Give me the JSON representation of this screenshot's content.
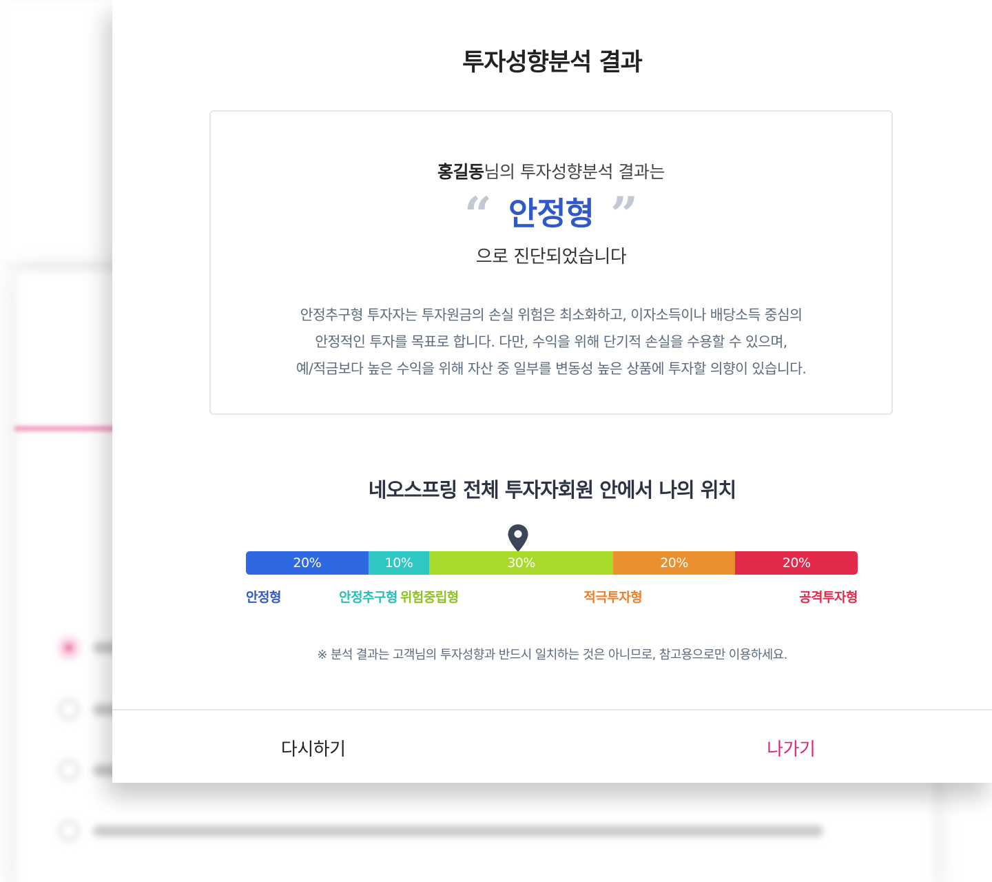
{
  "modal": {
    "title": "투자성향분석 결과"
  },
  "result": {
    "user_name": "홍길동",
    "intro_suffix": "님의 투자성향분석 결과는",
    "open_quote": "“",
    "close_quote": "”",
    "type": "안정형",
    "diagnosis_suffix": "으로 진단되었습니다",
    "description": [
      "안정추구형 투자자는 투자원금의 손실 위험은 최소화하고, 이자소득이나 배당소득 중심의",
      "안정적인 투자를 목표로 합니다. 다만, 수익을 위해 단기적 손실을 수용할 수 있으며,",
      "예/적금보다 높은 수익을 위해 자산 중 일부를 변동성 높은 상품에 투자할 의향이 있습니다."
    ]
  },
  "position": {
    "title": "네오스프링 전체 투자자회원 안에서 나의 위치",
    "pin_icon": "location-pin-icon",
    "segments": [
      {
        "name": "안정형",
        "share": 20,
        "label": "20%",
        "color": "#2f68e3",
        "label_color": "#2f59c9"
      },
      {
        "name": "안정추구형",
        "share": 10,
        "label": "10%",
        "color": "#2ec7c4",
        "label_color": "#27bdb8"
      },
      {
        "name": "위험중립형",
        "share": 30,
        "label": "30%",
        "color": "#a9d92a",
        "label_color": "#8cc21e"
      },
      {
        "name": "적극투자형",
        "share": 20,
        "label": "20%",
        "color": "#ea8f2e",
        "label_color": "#ea7e2a"
      },
      {
        "name": "공격투자형",
        "share": 20,
        "label": "20%",
        "color": "#e32a4a",
        "label_color": "#e32a4a"
      }
    ]
  },
  "notice": "※ 분석 결과는 고객님의 투자성향과 반드시 일치하는 것은 아니므로, 참고용으로만 이용하세요.",
  "footer": {
    "retry_label": "다시하기",
    "exit_label": "나가기"
  },
  "colors": {
    "accent_blue": "#2f59c9",
    "exit_pink": "#e0247c"
  }
}
